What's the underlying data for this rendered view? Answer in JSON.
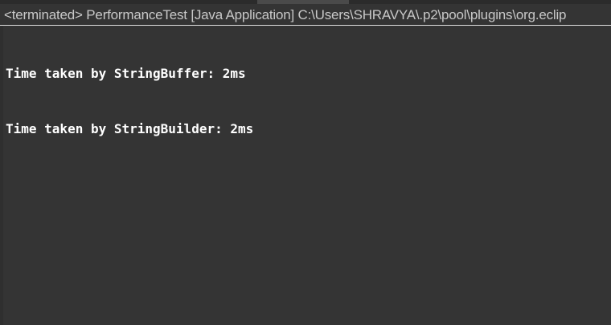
{
  "console": {
    "header": "<terminated> PerformanceTest [Java Application] C:\\Users\\SHRAVYA\\.p2\\pool\\plugins\\org.eclip",
    "output_lines": [
      "Time taken by StringBuffer: 2ms",
      "Time taken by StringBuilder: 2ms"
    ]
  },
  "colors": {
    "background": "#343434",
    "text": "#ffffff",
    "header_text": "#c8c8c8"
  }
}
